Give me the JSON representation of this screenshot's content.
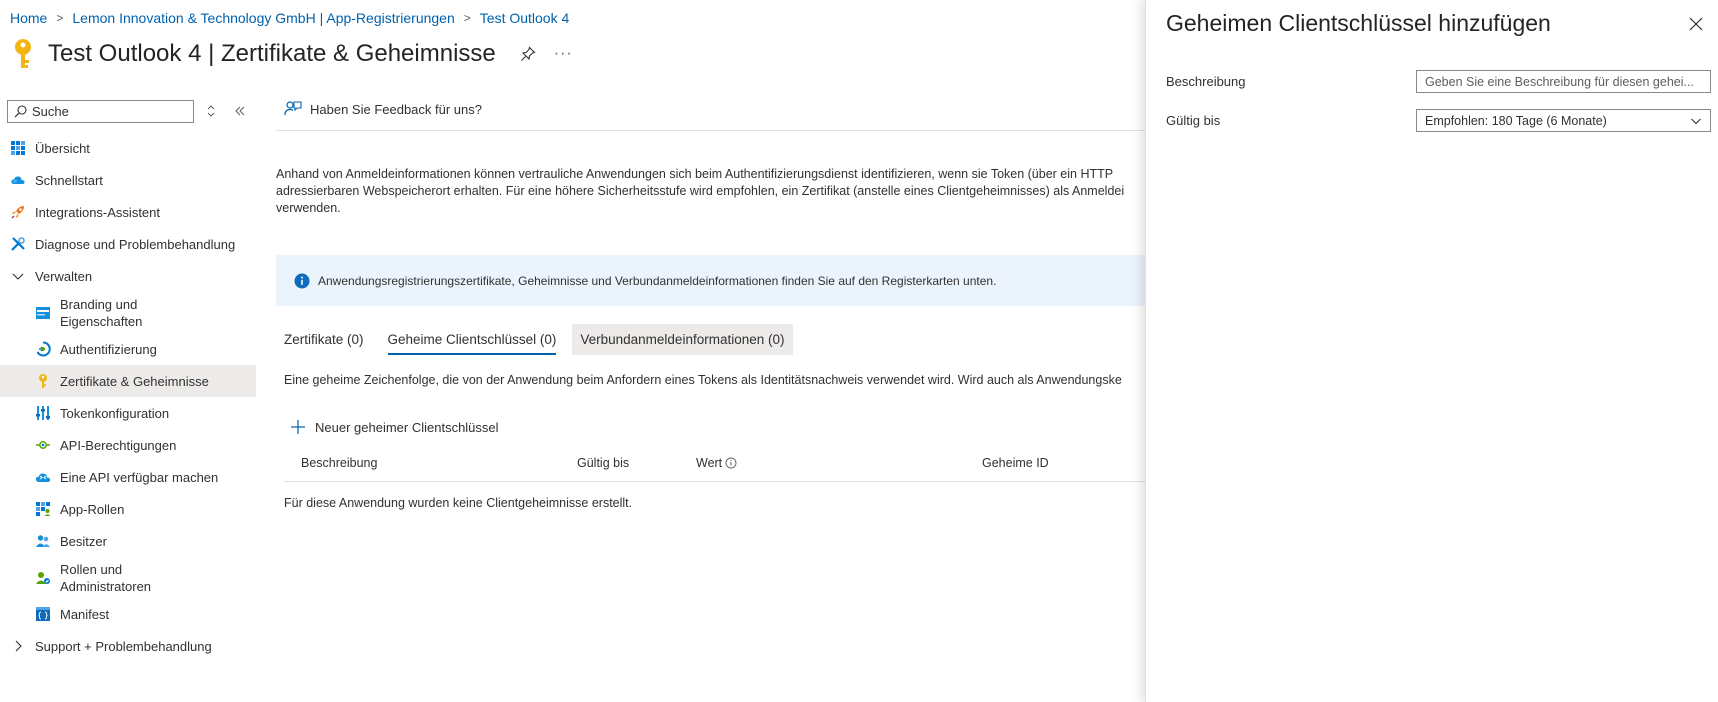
{
  "breadcrumb": [
    {
      "label": "Home"
    },
    {
      "label": "Lemon Innovation & Technology GmbH | App-Registrierungen"
    },
    {
      "label": "Test Outlook 4"
    }
  ],
  "page": {
    "title": "Test Outlook 4 | Zertifikate & Geheimnisse",
    "more": "···"
  },
  "sidebar": {
    "search_placeholder": "Suche",
    "items": [
      {
        "label": "Übersicht",
        "icon": "overview-icon"
      },
      {
        "label": "Schnellstart",
        "icon": "quickstart-cloud-icon"
      },
      {
        "label": "Integrations-Assistent",
        "icon": "rocket-icon"
      },
      {
        "label": "Diagnose und Problembehandlung",
        "icon": "wrench-icon"
      },
      {
        "label": "Verwalten",
        "icon": "chevron-down-icon"
      },
      {
        "label": "Branding und Eigenschaften",
        "icon": "branding-icon"
      },
      {
        "label": "Authentifizierung",
        "icon": "authentication-icon"
      },
      {
        "label": "Zertifikate & Geheimnisse",
        "icon": "key-icon"
      },
      {
        "label": "Tokenkonfiguration",
        "icon": "token-config-icon"
      },
      {
        "label": "API-Berechtigungen",
        "icon": "api-permissions-icon"
      },
      {
        "label": "Eine API verfügbar machen",
        "icon": "expose-api-cloud-icon"
      },
      {
        "label": "App-Rollen",
        "icon": "app-roles-icon"
      },
      {
        "label": "Besitzer",
        "icon": "owners-icon"
      },
      {
        "label": "Rollen und Administratoren",
        "icon": "roles-admins-icon"
      },
      {
        "label": "Manifest",
        "icon": "manifest-icon"
      },
      {
        "label": "Support + Problembehandlung",
        "icon": "chevron-right-icon"
      }
    ]
  },
  "main": {
    "feedback": "Haben Sie Feedback für uns?",
    "intro_line1": "Anhand von Anmeldeinformationen können vertrauliche Anwendungen sich beim Authentifizierungsdienst identifizieren, wenn sie Token (über ein HTTP",
    "intro_line2": "adressierbaren Webspeicherort erhalten. Für eine höhere Sicherheitsstufe wird empfohlen, ein Zertifikat (anstelle eines Clientgeheimnisses) als Anmeldei",
    "intro_line3": "verwenden.",
    "info": "Anwendungsregistrierungszertifikate, Geheimnisse und Verbundanmeldeinformationen finden Sie auf den Registerkarten unten.",
    "tabs": [
      {
        "label": "Zertifikate (0)"
      },
      {
        "label": "Geheime Clientschlüssel (0)"
      },
      {
        "label": "Verbundanmeldeinformationen (0)"
      }
    ],
    "description": "Eine geheime Zeichenfolge, die von der Anwendung beim Anfordern eines Tokens als Identitätsnachweis verwendet wird. Wird auch als Anwendungske",
    "new_secret": "Neuer geheimer Clientschlüssel",
    "columns": [
      "Beschreibung",
      "Gültig bis",
      "Wert",
      "Geheime ID"
    ],
    "empty": "Für diese Anwendung wurden keine Clientgeheimnisse erstellt."
  },
  "panel": {
    "title": "Geheimen Clientschlüssel hinzufügen",
    "description_label": "Beschreibung",
    "description_placeholder": "Geben Sie eine Beschreibung für diesen gehei...",
    "description_value": "",
    "expires_label": "Gültig bis",
    "expires_value": "Empfohlen: 180 Tage (6 Monate)"
  },
  "colors": {
    "link": "#0062ad",
    "accent": "#0062ad",
    "key": "#f2b514",
    "info_bg": "#ebf3fc",
    "selected_bg": "#edebe9"
  }
}
